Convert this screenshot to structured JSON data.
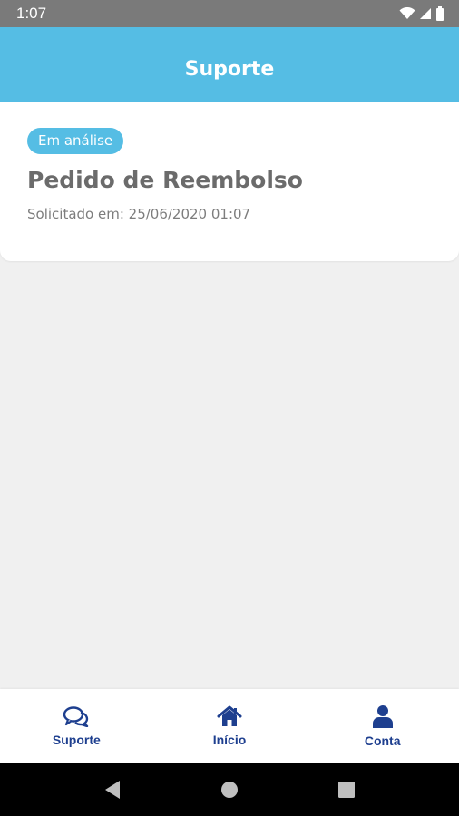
{
  "status_bar": {
    "time": "1:07",
    "icons": [
      "wifi-icon",
      "signal-icon",
      "battery-icon"
    ]
  },
  "app_bar": {
    "title": "Suporte"
  },
  "request_card": {
    "status_badge": "Em análise",
    "title": "Pedido de Reembolso",
    "subtitle": "Solicitado em: 25/06/2020 01:07"
  },
  "bottom_nav": {
    "items": [
      {
        "label": "Suporte",
        "icon": "chat-bubbles-icon"
      },
      {
        "label": "Início",
        "icon": "home-icon"
      },
      {
        "label": "Conta",
        "icon": "user-icon"
      }
    ]
  },
  "system_nav": {
    "buttons": [
      "back-icon",
      "home-circle-icon",
      "recents-icon"
    ]
  },
  "colors": {
    "primary": "#55bde4",
    "nav_accent": "#1e3f8f",
    "background": "#f0f0f0"
  }
}
